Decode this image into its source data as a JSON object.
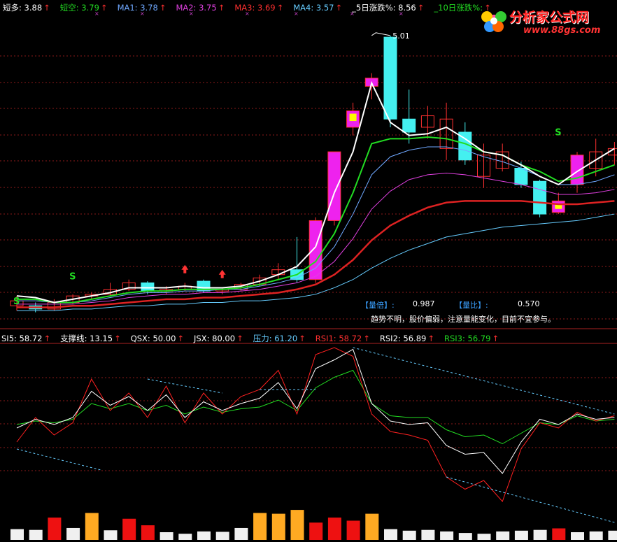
{
  "main_header": [
    {
      "label": "短多: 3.88",
      "color": "#ffffff"
    },
    {
      "label": "短空: 3.79",
      "color": "#22dd22"
    },
    {
      "label": "MA1: 3.78",
      "color": "#6fa8ff"
    },
    {
      "label": "MA2: 3.75",
      "color": "#e040e0"
    },
    {
      "label": "MA3: 3.69",
      "color": "#ff3030"
    },
    {
      "label": "MA4: 3.57",
      "color": "#66ccff"
    },
    {
      "label": "_5日涨跌%: 8.56",
      "color": "#ffffff"
    },
    {
      "label": "_10日涨跌%:",
      "color": "#22dd22"
    }
  ],
  "logo": {
    "title": "分析家公式网",
    "url": "www.88gs.com"
  },
  "annotations": {
    "peak_label": "5.01",
    "volume_ratio_label": "【量倍】:",
    "volume_ratio_value": "0.987",
    "volume_compare_label": "【量比】:",
    "volume_compare_value": "0.570",
    "advice": "趋势不明，股价偏弱，注意量能变化，目前不宜参与。",
    "signal_s": "S"
  },
  "sub_header": [
    {
      "label": "SI5: 58.72",
      "color": "#ffffff"
    },
    {
      "label": "支撑线: 13.15",
      "color": "#ffffff"
    },
    {
      "label": "QSX: 50.00",
      "color": "#ffffff"
    },
    {
      "label": "JSX: 80.00",
      "color": "#ffffff"
    },
    {
      "label": "压力: 61.20",
      "color": "#66ccff"
    },
    {
      "label": "RSI1: 58.72",
      "color": "#ff3030"
    },
    {
      "label": "RSI2: 56.89",
      "color": "#ffffff"
    },
    {
      "label": "RSI3: 56.79",
      "color": "#22dd22"
    }
  ],
  "colors": {
    "up": "#ff3030",
    "down": "#44f0f0",
    "magenta": "#ee22ee",
    "yellow": "#ffff00",
    "orange": "#ffaa22",
    "grid": "#8b1a1a"
  },
  "chart_data": {
    "type": "candlestick",
    "candles": [
      {
        "o": 3.39,
        "h": 3.42,
        "l": 3.33,
        "c": 3.36,
        "type": "up"
      },
      {
        "o": 3.36,
        "h": 3.38,
        "l": 3.32,
        "c": 3.34,
        "type": "down"
      },
      {
        "o": 3.34,
        "h": 3.4,
        "l": 3.33,
        "c": 3.38,
        "type": "up"
      },
      {
        "o": 3.38,
        "h": 3.43,
        "l": 3.37,
        "c": 3.42,
        "type": "up"
      },
      {
        "o": 3.42,
        "h": 3.44,
        "l": 3.4,
        "c": 3.43,
        "type": "up"
      },
      {
        "o": 3.43,
        "h": 3.5,
        "l": 3.42,
        "c": 3.46,
        "type": "up"
      },
      {
        "o": 3.46,
        "h": 3.52,
        "l": 3.45,
        "c": 3.5,
        "type": "up"
      },
      {
        "o": 3.5,
        "h": 3.51,
        "l": 3.43,
        "c": 3.45,
        "type": "down"
      },
      {
        "o": 3.45,
        "h": 3.48,
        "l": 3.43,
        "c": 3.46,
        "type": "up"
      },
      {
        "o": 3.46,
        "h": 3.5,
        "l": 3.45,
        "c": 3.48,
        "type": "up"
      },
      {
        "o": 3.51,
        "h": 3.52,
        "l": 3.44,
        "c": 3.45,
        "type": "down"
      },
      {
        "o": 3.45,
        "h": 3.47,
        "l": 3.43,
        "c": 3.46,
        "type": "up"
      },
      {
        "o": 3.46,
        "h": 3.5,
        "l": 3.45,
        "c": 3.49,
        "type": "up"
      },
      {
        "o": 3.49,
        "h": 3.55,
        "l": 3.48,
        "c": 3.53,
        "type": "up"
      },
      {
        "o": 3.55,
        "h": 3.62,
        "l": 3.52,
        "c": 3.58,
        "type": "up"
      },
      {
        "o": 3.58,
        "h": 3.78,
        "l": 3.5,
        "c": 3.52,
        "type": "down"
      },
      {
        "o": 3.52,
        "h": 3.9,
        "l": 3.5,
        "c": 3.88,
        "type": "magenta"
      },
      {
        "o": 3.88,
        "h": 4.3,
        "l": 3.85,
        "c": 4.3,
        "type": "magenta"
      },
      {
        "o": 4.45,
        "h": 4.6,
        "l": 4.4,
        "c": 4.55,
        "type": "magenta-yellow"
      },
      {
        "o": 4.7,
        "h": 4.78,
        "l": 4.62,
        "c": 4.75,
        "type": "magenta"
      },
      {
        "o": 5.0,
        "h": 5.01,
        "l": 4.45,
        "c": 4.5,
        "type": "down"
      },
      {
        "o": 4.5,
        "h": 4.68,
        "l": 4.35,
        "c": 4.42,
        "type": "down"
      },
      {
        "o": 4.45,
        "h": 4.58,
        "l": 4.38,
        "c": 4.52,
        "type": "up"
      },
      {
        "o": 4.5,
        "h": 4.6,
        "l": 4.25,
        "c": 4.32,
        "type": "up"
      },
      {
        "o": 4.42,
        "h": 4.48,
        "l": 4.22,
        "c": 4.25,
        "type": "down"
      },
      {
        "o": 4.28,
        "h": 4.35,
        "l": 4.08,
        "c": 4.15,
        "type": "up"
      },
      {
        "o": 4.3,
        "h": 4.35,
        "l": 4.18,
        "c": 4.2,
        "type": "up"
      },
      {
        "o": 4.2,
        "h": 4.24,
        "l": 4.08,
        "c": 4.1,
        "type": "down"
      },
      {
        "o": 4.12,
        "h": 4.13,
        "l": 3.9,
        "c": 3.92,
        "type": "down"
      },
      {
        "o": 3.93,
        "h": 4.05,
        "l": 3.92,
        "c": 4.0,
        "type": "magenta-yellow"
      },
      {
        "o": 4.1,
        "h": 4.3,
        "l": 4.05,
        "c": 4.28,
        "type": "magenta"
      },
      {
        "o": 4.2,
        "h": 4.38,
        "l": 4.15,
        "c": 4.3,
        "type": "up"
      },
      {
        "o": 4.28,
        "h": 4.36,
        "l": 4.22,
        "c": 4.32,
        "type": "up"
      }
    ],
    "lines": {
      "short_long": [
        3.42,
        3.41,
        3.38,
        3.4,
        3.42,
        3.44,
        3.47,
        3.47,
        3.47,
        3.48,
        3.47,
        3.47,
        3.48,
        3.51,
        3.55,
        3.6,
        3.72,
        4.05,
        4.3,
        4.72,
        4.48,
        4.4,
        4.41,
        4.45,
        4.38,
        4.3,
        4.28,
        4.22,
        4.15,
        4.1,
        4.18,
        4.25,
        4.32
      ],
      "short_short": [
        3.4,
        3.4,
        3.38,
        3.38,
        3.4,
        3.42,
        3.44,
        3.45,
        3.45,
        3.46,
        3.46,
        3.46,
        3.47,
        3.49,
        3.52,
        3.55,
        3.63,
        3.8,
        4.05,
        4.35,
        4.38,
        4.38,
        4.39,
        4.38,
        4.35,
        4.3,
        4.28,
        4.22,
        4.18,
        4.12,
        4.14,
        4.18,
        4.22
      ],
      "ma1": [
        3.39,
        3.39,
        3.38,
        3.38,
        3.39,
        3.41,
        3.43,
        3.44,
        3.44,
        3.45,
        3.45,
        3.46,
        3.46,
        3.48,
        3.5,
        3.53,
        3.59,
        3.72,
        3.92,
        4.16,
        4.27,
        4.31,
        4.33,
        4.33,
        4.31,
        4.27,
        4.24,
        4.2,
        4.15,
        4.1,
        4.1,
        4.12,
        4.16
      ],
      "ma2": [
        3.37,
        3.37,
        3.37,
        3.37,
        3.38,
        3.39,
        3.41,
        3.42,
        3.43,
        3.43,
        3.44,
        3.44,
        3.45,
        3.46,
        3.48,
        3.5,
        3.54,
        3.63,
        3.77,
        3.95,
        4.06,
        4.13,
        4.16,
        4.17,
        4.16,
        4.14,
        4.12,
        4.1,
        4.07,
        4.04,
        4.04,
        4.05,
        4.07
      ],
      "ma3": [
        3.35,
        3.35,
        3.35,
        3.36,
        3.36,
        3.37,
        3.38,
        3.39,
        3.4,
        3.4,
        3.41,
        3.41,
        3.42,
        3.43,
        3.44,
        3.46,
        3.49,
        3.55,
        3.64,
        3.76,
        3.85,
        3.91,
        3.96,
        3.99,
        4.0,
        4.0,
        4.0,
        4.0,
        3.99,
        3.98,
        3.98,
        3.99,
        4.0
      ],
      "ma4": [
        3.33,
        3.33,
        3.33,
        3.34,
        3.34,
        3.35,
        3.36,
        3.36,
        3.37,
        3.37,
        3.38,
        3.38,
        3.39,
        3.39,
        3.4,
        3.41,
        3.43,
        3.47,
        3.52,
        3.59,
        3.65,
        3.7,
        3.74,
        3.78,
        3.8,
        3.82,
        3.84,
        3.85,
        3.86,
        3.87,
        3.88,
        3.9,
        3.92
      ]
    },
    "price_range": [
      3.22,
      5.15
    ],
    "rsi": {
      "rsi1": [
        44,
        58,
        48,
        55,
        80,
        62,
        72,
        58,
        76,
        55,
        72,
        60,
        70,
        74,
        85,
        60,
        94,
        98,
        93,
        60,
        50,
        48,
        45,
        24,
        17,
        22,
        10,
        40,
        55,
        52,
        61,
        56,
        59
      ],
      "rsi2": [
        52,
        57,
        54,
        58,
        73,
        65,
        70,
        62,
        71,
        58,
        67,
        62,
        66,
        69,
        78,
        63,
        86,
        91,
        97,
        66,
        56,
        54,
        55,
        42,
        37,
        38,
        26,
        44,
        57,
        54,
        60,
        57,
        58
      ],
      "rsi3": [
        54,
        56,
        55,
        57,
        66,
        63,
        66,
        62,
        65,
        60,
        64,
        61,
        63,
        64,
        68,
        62,
        75,
        81,
        85,
        66,
        59,
        58,
        58,
        51,
        47,
        48,
        43,
        49,
        55,
        54,
        59,
        56,
        57
      ],
      "range": [
        0,
        100
      ]
    },
    "volume_bars": [
      {
        "v": 28,
        "c": "white"
      },
      {
        "v": 26,
        "c": "white"
      },
      {
        "v": 58,
        "c": "red"
      },
      {
        "v": 31,
        "c": "white"
      },
      {
        "v": 70,
        "c": "orange"
      },
      {
        "v": 25,
        "c": "white"
      },
      {
        "v": 55,
        "c": "red"
      },
      {
        "v": 38,
        "c": "red"
      },
      {
        "v": 20,
        "c": "white"
      },
      {
        "v": 16,
        "c": "white"
      },
      {
        "v": 22,
        "c": "white"
      },
      {
        "v": 21,
        "c": "white"
      },
      {
        "v": 31,
        "c": "white"
      },
      {
        "v": 70,
        "c": "orange"
      },
      {
        "v": 68,
        "c": "orange"
      },
      {
        "v": 78,
        "c": "orange"
      },
      {
        "v": 45,
        "c": "red"
      },
      {
        "v": 58,
        "c": "red"
      },
      {
        "v": 50,
        "c": "red"
      },
      {
        "v": 68,
        "c": "orange"
      },
      {
        "v": 28,
        "c": "white"
      },
      {
        "v": 24,
        "c": "white"
      },
      {
        "v": 26,
        "c": "white"
      },
      {
        "v": 22,
        "c": "white"
      },
      {
        "v": 18,
        "c": "white"
      },
      {
        "v": 16,
        "c": "white"
      },
      {
        "v": 22,
        "c": "white"
      },
      {
        "v": 24,
        "c": "white"
      },
      {
        "v": 26,
        "c": "white"
      },
      {
        "v": 30,
        "c": "red"
      },
      {
        "v": 20,
        "c": "white"
      },
      {
        "v": 22,
        "c": "white"
      },
      {
        "v": 24,
        "c": "white"
      }
    ]
  }
}
